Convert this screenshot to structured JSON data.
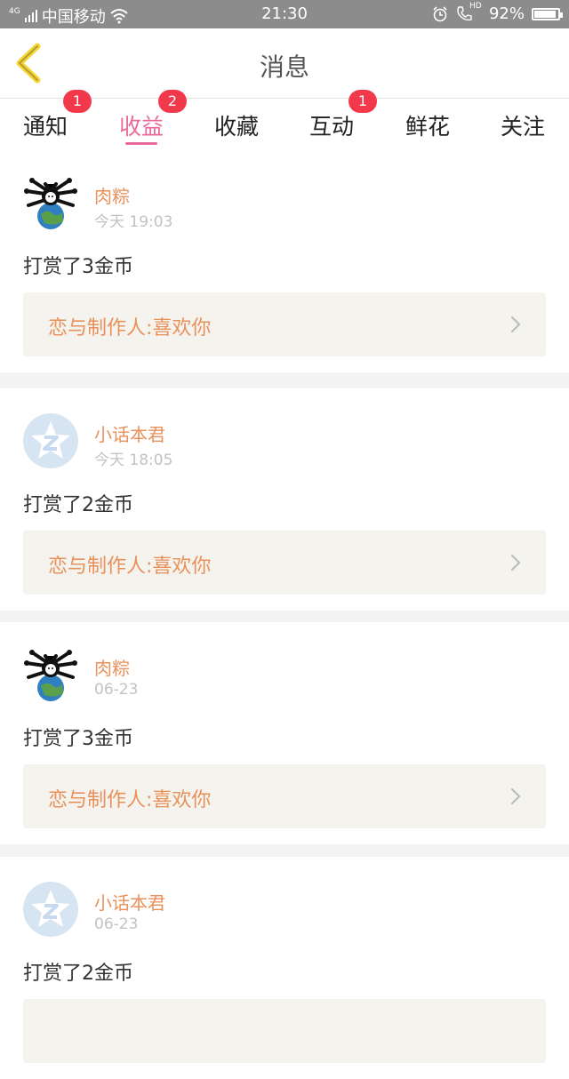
{
  "status_bar": {
    "network": "4G",
    "carrier": "中国移动",
    "time": "21:30",
    "hd_label": "HD",
    "battery_text": "92%",
    "battery_level": 0.92,
    "icons": [
      "signal-icon",
      "wifi-icon",
      "alarm-icon",
      "volte-call-icon",
      "battery-icon"
    ]
  },
  "nav": {
    "title": "消息",
    "back_icon": "chevron-left-icon",
    "accent": "#f7d634"
  },
  "tabs": [
    {
      "label": "通知",
      "badge": "1"
    },
    {
      "label": "收益",
      "badge": "2",
      "active": true
    },
    {
      "label": "收藏",
      "badge": ""
    },
    {
      "label": "互动",
      "badge": "1"
    },
    {
      "label": "鲜花",
      "badge": ""
    },
    {
      "label": "关注",
      "badge": ""
    }
  ],
  "colors": {
    "active_tab": "#e9699b",
    "badge": "#f2394b",
    "name": "#e9915a",
    "link_bg": "#f4f3ee"
  },
  "messages": [
    {
      "name": "肉粽",
      "time": "今天 19:03",
      "action": "打赏了3金币",
      "work": "恋与制作人:喜欢你",
      "avatar_icon": "spider-globe-avatar-icon"
    },
    {
      "name": "小话本君",
      "time": "今天 18:05",
      "action": "打赏了2金币",
      "work": "恋与制作人:喜欢你",
      "avatar_icon": "star-z-avatar-icon"
    },
    {
      "name": "肉粽",
      "time": "06-23",
      "action": "打赏了3金币",
      "work": "恋与制作人:喜欢你",
      "avatar_icon": "spider-globe-avatar-icon"
    },
    {
      "name": "小话本君",
      "time": "06-23",
      "action": "打赏了2金币",
      "work": "",
      "avatar_icon": "star-z-avatar-icon"
    }
  ]
}
